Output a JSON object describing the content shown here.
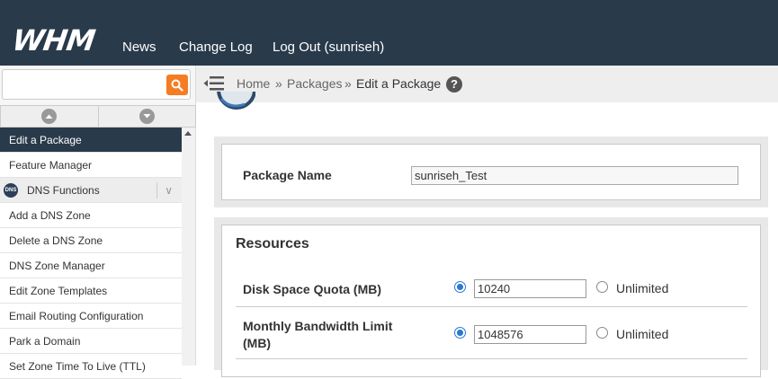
{
  "header": {
    "logo_text": "WHM",
    "nav": [
      {
        "label": "News"
      },
      {
        "label": "Change Log"
      },
      {
        "label": "Log Out (sunriseh)"
      }
    ]
  },
  "sidebar": {
    "search": {
      "placeholder": "",
      "value": ""
    },
    "items": [
      {
        "label": "Edit a Package",
        "active": true
      },
      {
        "label": "Feature Manager"
      },
      {
        "label": "DNS Functions",
        "group": true,
        "badge": "DNS"
      },
      {
        "label": "Add a DNS Zone"
      },
      {
        "label": "Delete a DNS Zone"
      },
      {
        "label": "DNS Zone Manager"
      },
      {
        "label": "Edit Zone Templates"
      },
      {
        "label": "Email Routing Configuration"
      },
      {
        "label": "Park a Domain"
      },
      {
        "label": "Set Zone Time To Live (TTL)"
      }
    ]
  },
  "breadcrumb": {
    "home": "Home",
    "sep1": "»",
    "packages": "Packages",
    "sep2": "»",
    "current": "Edit a Package"
  },
  "package": {
    "name_label": "Package Name",
    "name_value": "sunriseh_Test"
  },
  "resources": {
    "title": "Resources",
    "rows": [
      {
        "label": "Disk Space Quota (MB)",
        "value": "10240",
        "unlimited_label": "Unlimited",
        "limited_selected": true
      },
      {
        "label_line1": "Monthly Bandwidth Limit",
        "label_line2": "(MB)",
        "value": "1048576",
        "unlimited_label": "Unlimited",
        "limited_selected": true
      }
    ]
  },
  "colors": {
    "topbar": "#293a4a",
    "accent_orange": "#f57c23",
    "radio_blue": "#2a7ad5"
  }
}
